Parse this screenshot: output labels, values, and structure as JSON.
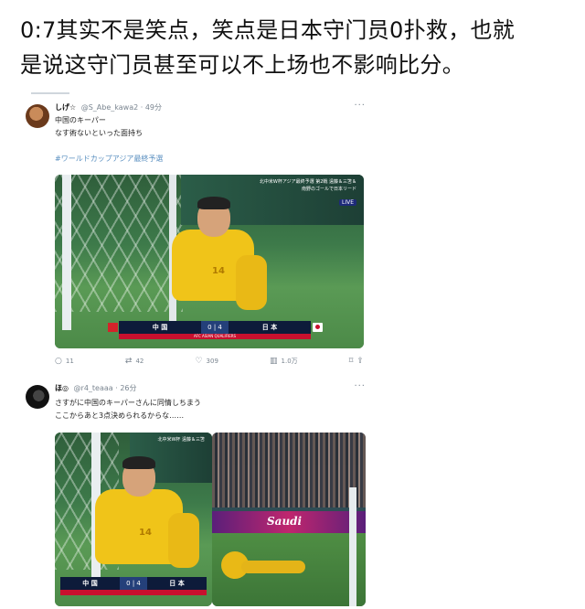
{
  "caption": {
    "line1": "0:7其实不是笑点，笑点是日本守门员0扑救，也就",
    "line2": "是说这守门员甚至可以不上场也不影响比分。"
  },
  "tweet1": {
    "name": "しげ☆",
    "handle": "@S_Abe_kawa2",
    "time": "· 49分",
    "more": "···",
    "text1": "中国のキーパー",
    "text2": "なす術ないといった面持ち",
    "hashtag": "#ワールドカップアジア最終予選",
    "media": {
      "banner": "北中米W杯アジア最終予選 第2戦 遠藤＆三笘＆南野のゴールで日本リード",
      "live": "LIVE",
      "jersey": "14",
      "team_left": "中 国",
      "score": "0 | 4",
      "team_right": "日 本",
      "sub": "AFC ASIAN QUALIFIERS"
    },
    "actions": {
      "replies": "11",
      "reposts": "42",
      "likes": "309",
      "views": "1.0万"
    }
  },
  "tweet2": {
    "name": "ほ◎",
    "handle": "@r4_teaaa",
    "time": "· 26分",
    "more": "···",
    "text1": "さすがに中国のキーパーさんに同情しちまう",
    "text2": "ここからあと3点決められるからな……",
    "media": {
      "banner": "北中米W杯 遠藤＆三笘",
      "jersey": "14",
      "team_left": "中 国",
      "score": "0 | 4",
      "team_right": "日 本",
      "ad": "Saudi"
    }
  },
  "colors": {
    "link": "#5a8fc0",
    "meta": "#7a8590",
    "jersey": "#f0c419"
  }
}
